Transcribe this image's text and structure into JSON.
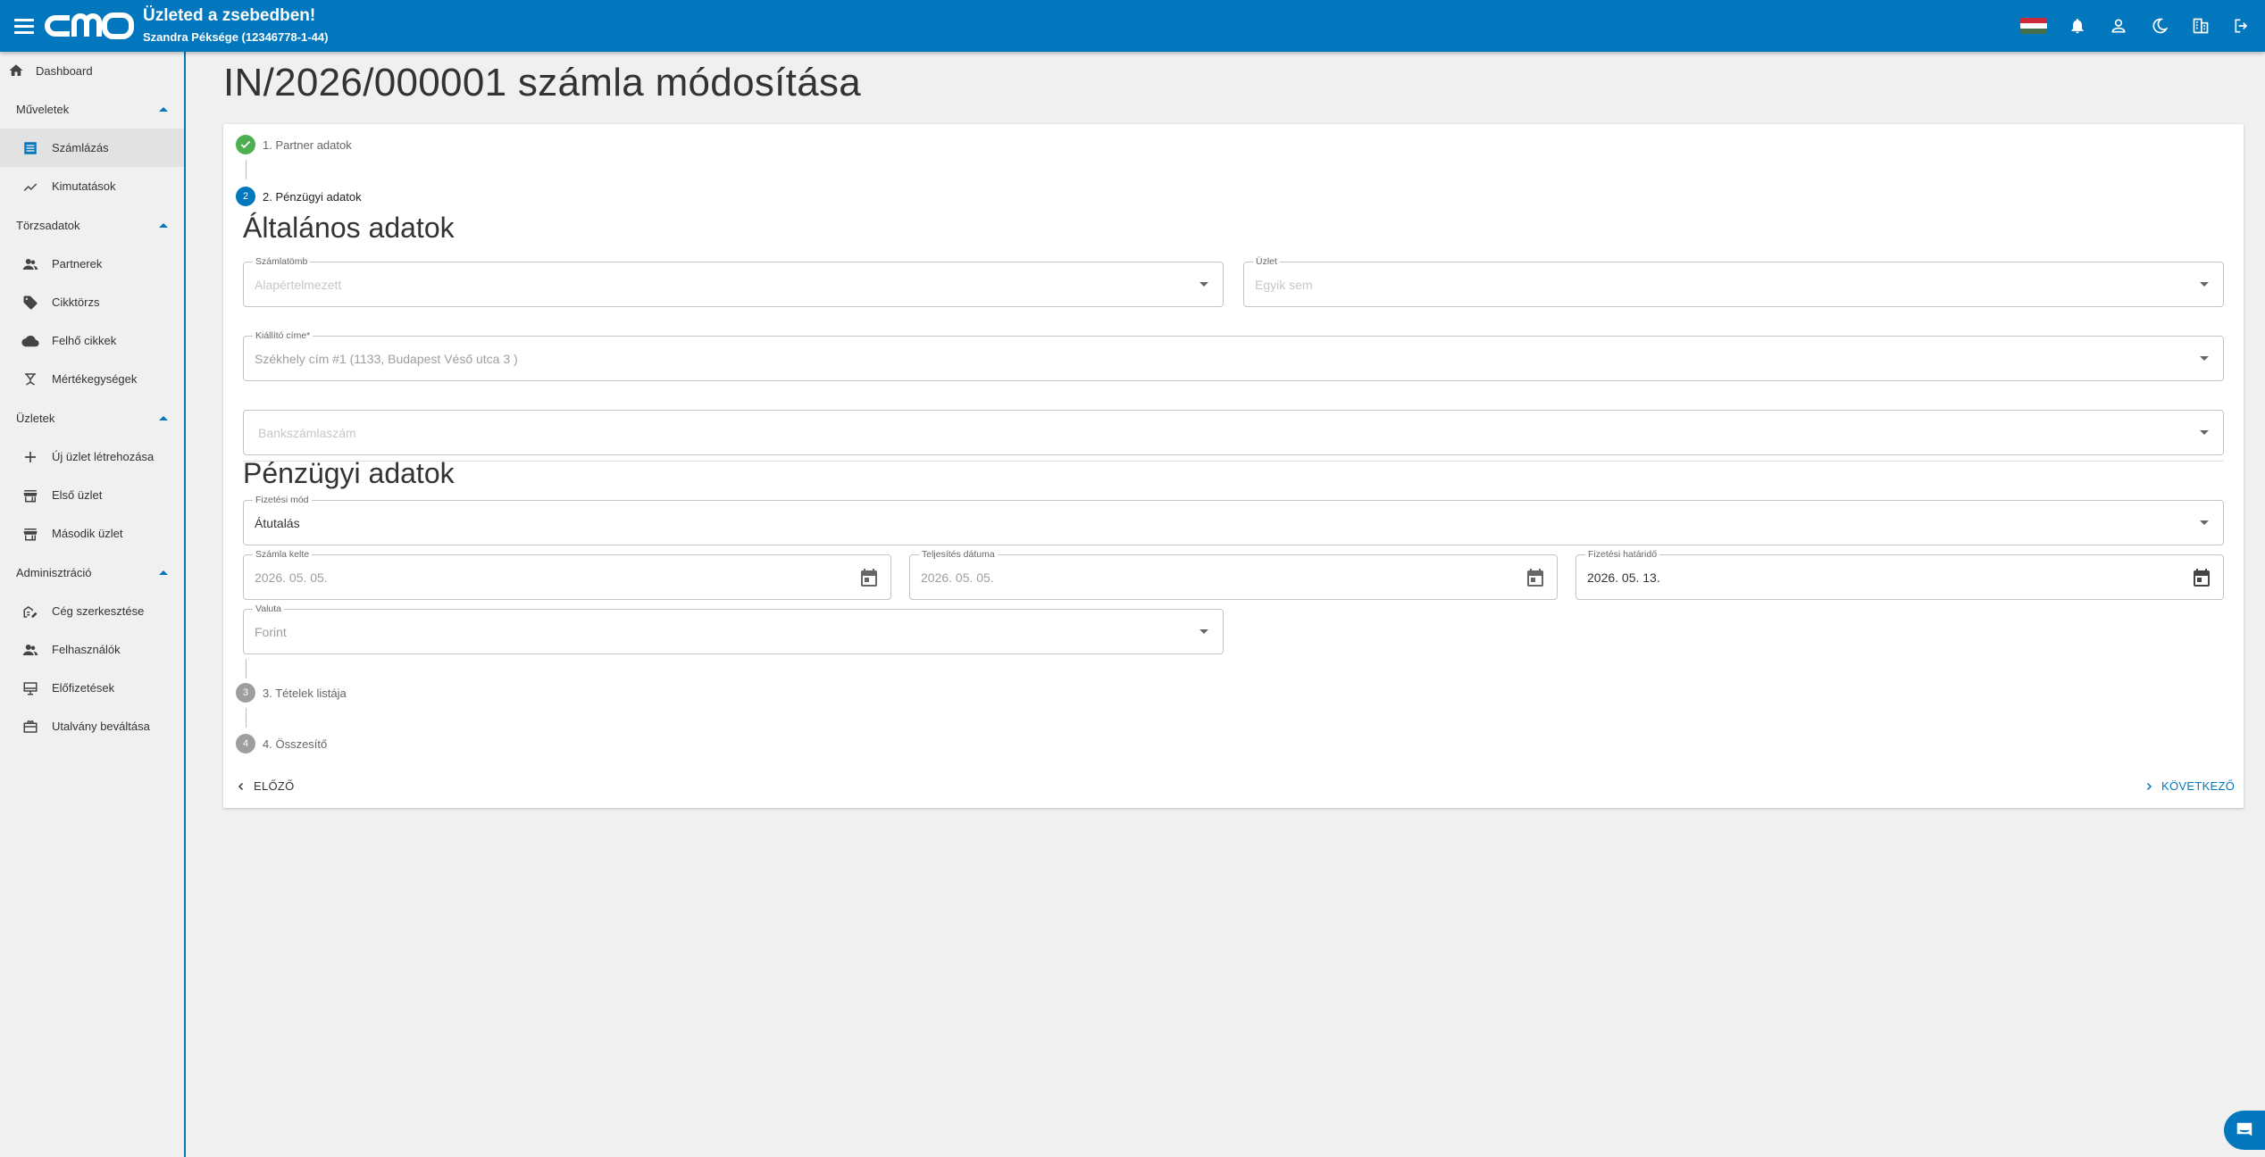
{
  "header": {
    "title": "Üzleted a zsebedben!",
    "subtitle": "Szandra Péksége (12346778-1-44)",
    "logo_text": "cmo"
  },
  "colors": {
    "primary": "#0277bd",
    "success": "#4caf50",
    "step_inactive": "#9e9e9e"
  },
  "sidebar": {
    "dashboard": "Dashboard",
    "groups": [
      {
        "label": "Műveletek",
        "items": [
          "Számlázás",
          "Kimutatások"
        ]
      },
      {
        "label": "Törzsadatok",
        "items": [
          "Partnerek",
          "Cikktörzs",
          "Felhő cikkek",
          "Mértékegységek"
        ]
      },
      {
        "label": "Üzletek",
        "items": [
          "Új üzlet létrehozása",
          "Első üzlet",
          "Második üzlet"
        ]
      },
      {
        "label": "Adminisztráció",
        "items": [
          "Cég szerkesztése",
          "Felhasználók",
          "Előfizetések",
          "Utalvány beváltása"
        ]
      }
    ]
  },
  "page": {
    "title": "IN/2026/000001 számla módosítása"
  },
  "steps": [
    {
      "number": "1",
      "label": "1. Partner adatok",
      "state": "done"
    },
    {
      "number": "2",
      "label": "2. Pénzügyi adatok",
      "state": "active"
    },
    {
      "number": "3",
      "label": "3. Tételek listája",
      "state": "pending"
    },
    {
      "number": "4",
      "label": "4. Összesítő",
      "state": "pending"
    }
  ],
  "general": {
    "title": "Általános adatok",
    "szamlatomb": {
      "label": "Számlatömb",
      "value": "Alapértelmezett"
    },
    "uzlet": {
      "label": "Üzlet",
      "value": "Egyik sem"
    },
    "kiallito": {
      "label": "Kiállító címe*",
      "value": "Székhely cím #1 (1133, Budapest Véső utca 3 )"
    },
    "bank": {
      "placeholder": "Bankszámlaszám"
    }
  },
  "financial": {
    "title": "Pénzügyi adatok",
    "fizetesi_mod": {
      "label": "Fizetési mód",
      "value": "Átutalás"
    },
    "szamla_kelte": {
      "label": "Számla kelte",
      "value": "2026. 05. 05."
    },
    "teljesites": {
      "label": "Teljesítés dátuma",
      "value": "2026. 05. 05."
    },
    "hatarido": {
      "label": "Fizetési határidő",
      "value": "2026. 05. 13."
    },
    "valuta": {
      "label": "Valuta",
      "value": "Forint"
    }
  },
  "nav": {
    "prev": "ELŐZŐ",
    "next": "KÖVETKEZŐ"
  }
}
